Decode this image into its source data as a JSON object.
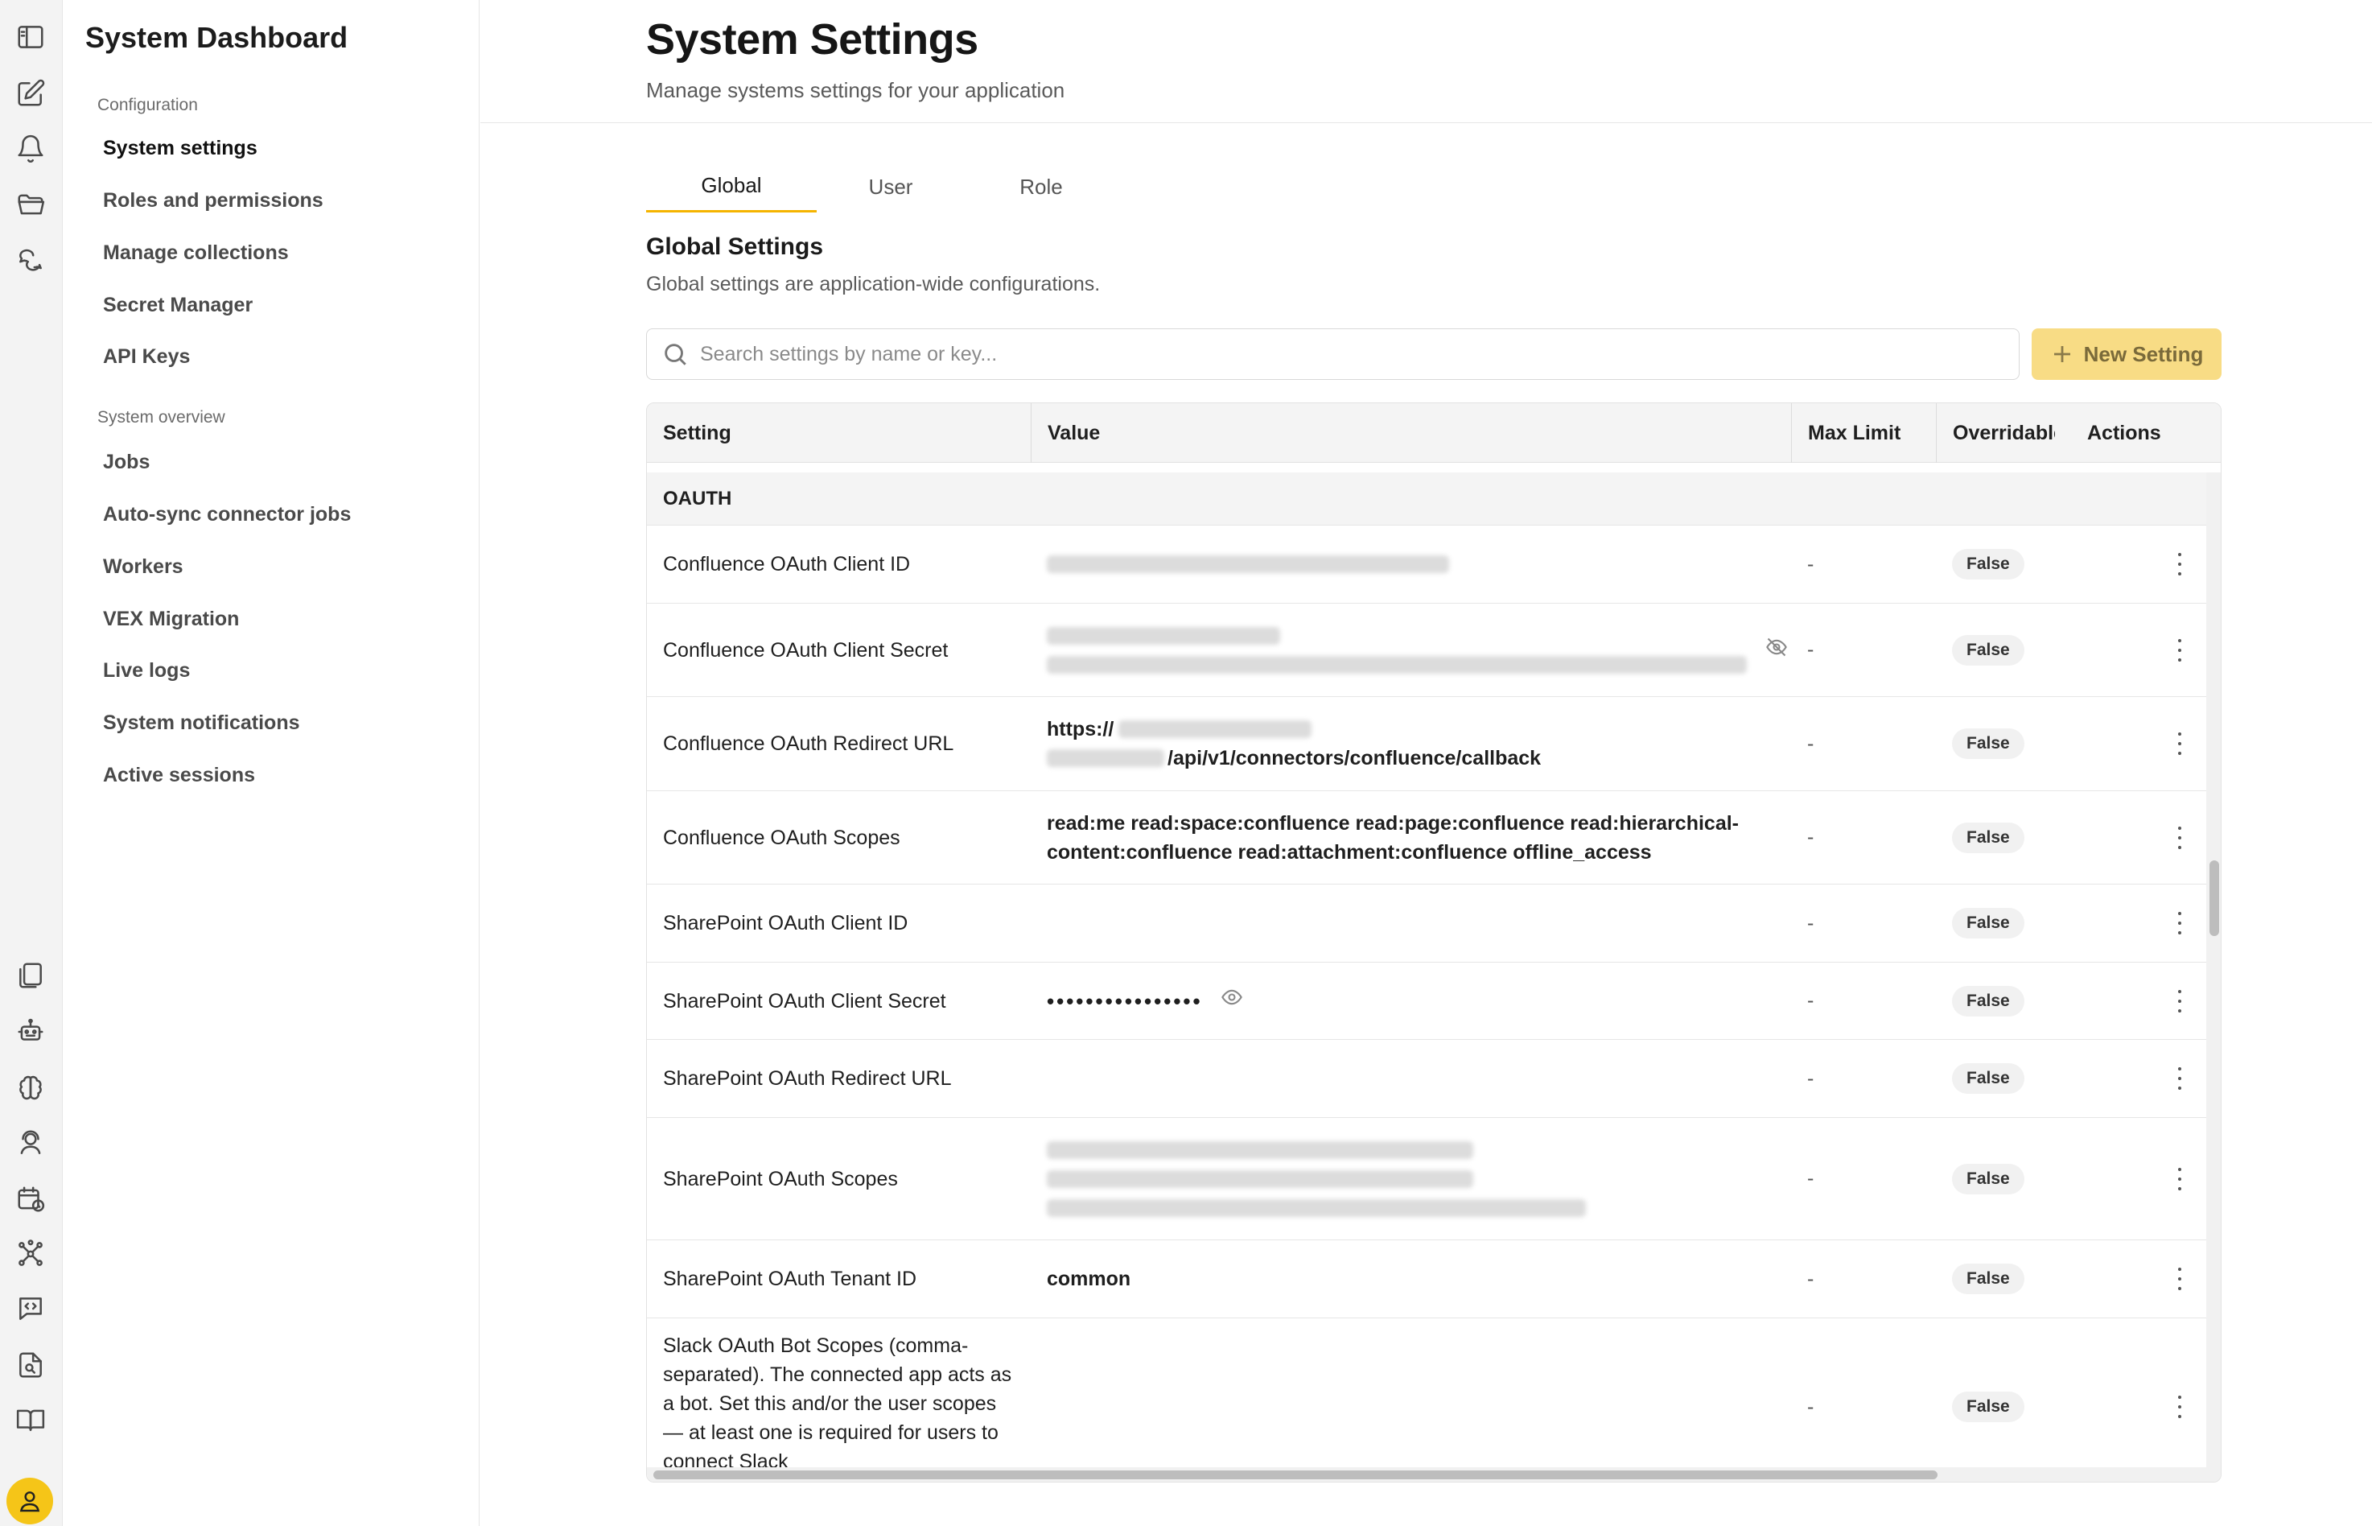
{
  "sidebar": {
    "app_title": "System Dashboard",
    "groups": [
      {
        "label": "Configuration",
        "items": [
          {
            "label": "System settings",
            "active": true
          },
          {
            "label": "Roles and permissions"
          },
          {
            "label": "Manage collections"
          },
          {
            "label": "Secret Manager"
          },
          {
            "label": "API Keys"
          }
        ]
      },
      {
        "label": "System overview",
        "items": [
          {
            "label": "Jobs"
          },
          {
            "label": "Auto-sync connector jobs"
          },
          {
            "label": "Workers"
          },
          {
            "label": "VEX Migration"
          },
          {
            "label": "Live logs"
          },
          {
            "label": "System notifications"
          },
          {
            "label": "Active sessions"
          }
        ]
      }
    ]
  },
  "rail_icons": [
    "sidebar-toggle-icon",
    "edit-icon",
    "bell-icon",
    "folder-icon",
    "chat-icon",
    "documents-icon",
    "robot-icon",
    "brain-icon",
    "support-agent-icon",
    "calendar-clock-icon",
    "network-icon",
    "code-message-icon",
    "file-search-icon",
    "book-icon",
    "user-icon"
  ],
  "header": {
    "title": "System Settings",
    "subtitle": "Manage systems settings for your application"
  },
  "tabs": [
    {
      "label": "Global",
      "active": true
    },
    {
      "label": "User"
    },
    {
      "label": "Role"
    }
  ],
  "section": {
    "title": "Global Settings",
    "description": "Global settings are application-wide configurations."
  },
  "search": {
    "placeholder": "Search settings by name or key...",
    "value": ""
  },
  "new_setting_label": "New Setting",
  "table": {
    "columns": [
      "Setting",
      "Value",
      "Max Limit",
      "Overridable",
      "Actions"
    ],
    "group": "OAUTH",
    "rows": [
      {
        "setting": "Confluence OAuth Client ID",
        "value_lines": [],
        "max": "-",
        "overridable": "False"
      },
      {
        "setting": "Confluence OAuth Client Secret",
        "value_lines": [],
        "max": "-",
        "overridable": "False"
      },
      {
        "setting": "Confluence OAuth Redirect URL",
        "value_lines": [
          "https://",
          "/api/v1/connectors/confluence/callback"
        ],
        "max": "-",
        "overridable": "False"
      },
      {
        "setting": "Confluence OAuth Scopes",
        "value_lines": [
          "read:me read:space:confluence read:page:confluence read:hierarchical-",
          "content:confluence read:attachment:confluence offline_access"
        ],
        "max": "-",
        "overridable": "False"
      },
      {
        "setting": "SharePoint OAuth Client ID",
        "value_lines": [],
        "max": "-",
        "overridable": "False"
      },
      {
        "setting": "SharePoint OAuth Client Secret",
        "value_lines": [
          "••••••••••••••••"
        ],
        "max": "-",
        "overridable": "False"
      },
      {
        "setting": "SharePoint OAuth Redirect URL",
        "value_lines": [],
        "max": "-",
        "overridable": "False"
      },
      {
        "setting": "SharePoint OAuth Scopes",
        "value_lines": [],
        "max": "-",
        "overridable": "False"
      },
      {
        "setting": "SharePoint OAuth Tenant ID",
        "value_lines": [
          "common"
        ],
        "max": "-",
        "overridable": "False"
      },
      {
        "setting": "Slack OAuth Bot Scopes (comma-separated). The connected app acts as a bot. Set this and/or the user scopes — at least one is required for users to connect Slack",
        "value_lines": [],
        "max": "-",
        "overridable": "False"
      }
    ]
  },
  "colors": {
    "accent": "#f5b400",
    "new_button_bg": "#f8dc85",
    "avatar": "#f5c518"
  }
}
